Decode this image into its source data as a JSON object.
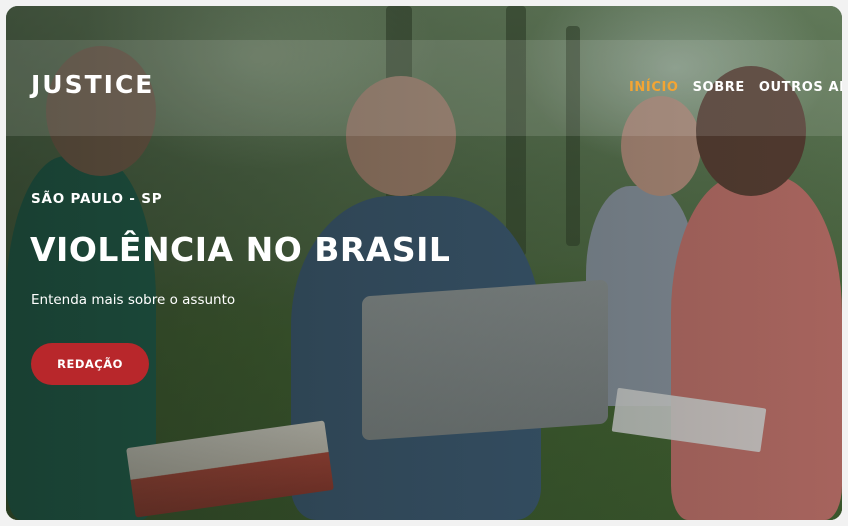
{
  "header": {
    "logo": "JUSTICE",
    "nav": [
      {
        "label": "INÍCIO",
        "active": true
      },
      {
        "label": "SOBRE",
        "active": false
      },
      {
        "label": "OUTROS ARG",
        "active": false
      }
    ]
  },
  "hero": {
    "location": "SÃO PAULO - SP",
    "title": "VIOLÊNCIA NO BRASIL",
    "subtitle": "Entenda mais sobre o assunto",
    "cta_label": "REDAÇÃO"
  },
  "colors": {
    "accent": "#f3a534",
    "button": "#b8272b"
  }
}
